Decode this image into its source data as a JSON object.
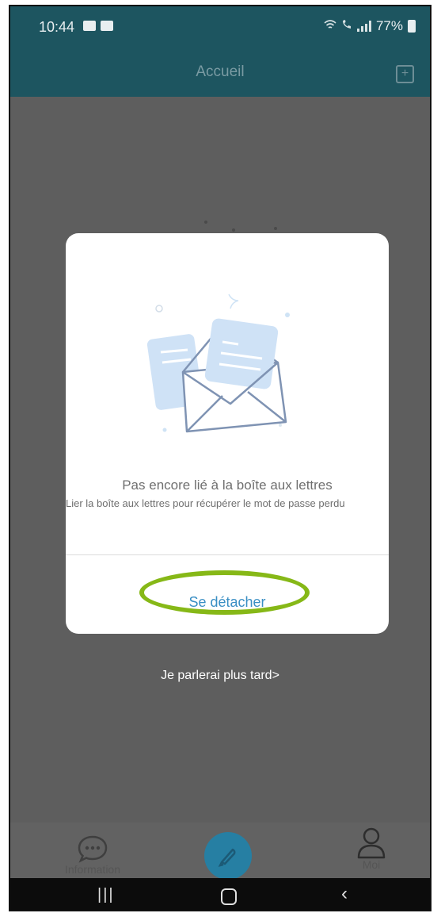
{
  "status_bar": {
    "time": "10:44",
    "battery": "77%"
  },
  "header": {
    "title": "Accueil",
    "add_icon": "plus-square-icon"
  },
  "dialog": {
    "illustration_icon": "envelope-letters-icon",
    "title": "Pas encore lié à la boîte aux lettres",
    "subtitle": "Lier la boîte aux lettres pour récupérer le mot de passe perdu",
    "detach_button": "Se détacher",
    "highlight_color": "#86b817"
  },
  "later_link": "Je parlerai plus tard>",
  "tabbar": {
    "information_label": "Information",
    "moi_label": "Moi",
    "compose_icon": "pen-icon"
  },
  "colors": {
    "header_bg": "#1d5560",
    "accent_blue": "#3a8fc4",
    "fab": "#267fa3"
  }
}
